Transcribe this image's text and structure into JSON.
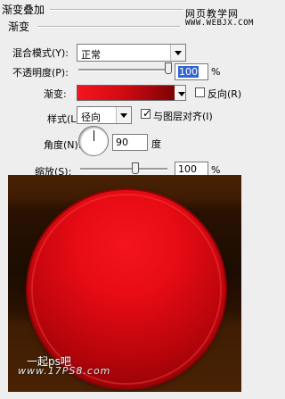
{
  "header": {
    "group_title": "渐变叠加",
    "sub_title": "渐变",
    "watermark_cn": "网页教学网",
    "watermark_url": "WWW.WEBJX.COM"
  },
  "blend_mode": {
    "label": "混合模式(Y):",
    "value": "正常"
  },
  "opacity": {
    "label": "不透明度(P):",
    "value": "100",
    "unit": "%",
    "level": 1.0
  },
  "gradient": {
    "label": "渐变:",
    "colors": [
      "#f4141e",
      "#d40b12",
      "#7e0206"
    ],
    "reverse_label": "反向(R)",
    "reverse_checked": false
  },
  "style": {
    "label": "样式(L):",
    "value": "径向"
  },
  "align": {
    "label": "与图层对齐(I)",
    "checked": true
  },
  "angle": {
    "label": "角度(N):",
    "value": "90",
    "unit": "度"
  },
  "scale": {
    "label": "缩放(S):",
    "value": "100",
    "unit": "%",
    "level": 1.0
  },
  "canvas_logo": {
    "line1": "一起ps吧",
    "line2": "www.17PS8.com"
  },
  "icons": {
    "dropdown": "chevron-down-icon",
    "check": "check-icon"
  }
}
